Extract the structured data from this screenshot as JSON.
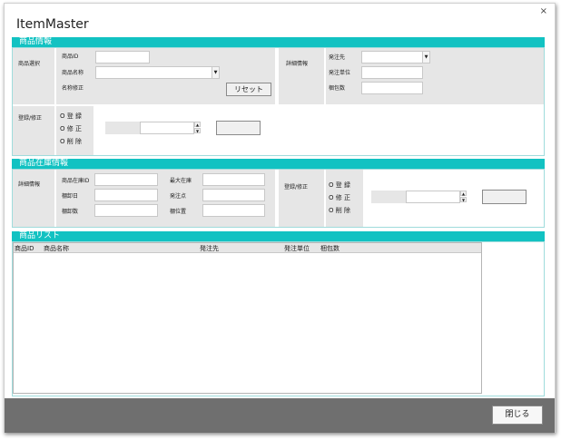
{
  "window": {
    "title": "ItemMaster",
    "close_glyph": "×"
  },
  "product_info": {
    "header": "商品情報",
    "select_label": "商品選択",
    "id_label": "商品ID",
    "id_value": "",
    "name_label": "商品名称",
    "name_value": "",
    "rename_label": "名称修正",
    "reset_label": "リセット",
    "details_label": "詳細情報",
    "supplier_label": "発注先",
    "supplier_value": "",
    "order_unit_label": "発注単位",
    "pack_count_label": "梱包数",
    "register_label": "登録/修正",
    "radio_register": "O 登 録",
    "radio_modify": "O 修 正",
    "radio_delete": "O 削 除",
    "action_button_label": ""
  },
  "stock_info": {
    "header": "商品在庫情報",
    "details_label": "詳細情報",
    "stock_id_label": "商品在庫ID",
    "shelf_label": "棚卸日",
    "shelf_count_label": "棚卸数",
    "max_stock_label": "最大在庫",
    "reorder_point_label": "発注点",
    "location_label": "棚位置",
    "register_label": "登録/修正",
    "radio_register": "O 登 録",
    "radio_modify": "O 修 正",
    "radio_delete": "O 削 除",
    "action_button_label": ""
  },
  "product_list": {
    "header": "商品リスト",
    "columns": [
      "商品ID",
      "商品名称",
      "発注先",
      "発注単位",
      "梱包数"
    ]
  },
  "footer": {
    "close_label": "閉じる"
  },
  "colors": {
    "accent": "#12c2c2",
    "panel_gray": "#e6e6e6",
    "footer": "#6f6f6f"
  }
}
